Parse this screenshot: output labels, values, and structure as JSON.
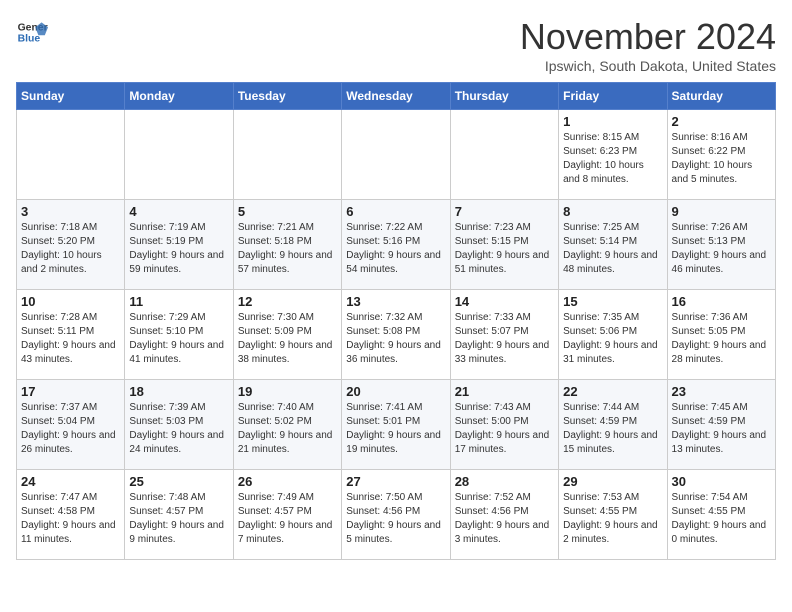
{
  "header": {
    "logo_line1": "General",
    "logo_line2": "Blue",
    "month": "November 2024",
    "location": "Ipswich, South Dakota, United States"
  },
  "weekdays": [
    "Sunday",
    "Monday",
    "Tuesday",
    "Wednesday",
    "Thursday",
    "Friday",
    "Saturday"
  ],
  "weeks": [
    [
      {
        "day": "",
        "info": ""
      },
      {
        "day": "",
        "info": ""
      },
      {
        "day": "",
        "info": ""
      },
      {
        "day": "",
        "info": ""
      },
      {
        "day": "",
        "info": ""
      },
      {
        "day": "1",
        "info": "Sunrise: 8:15 AM\nSunset: 6:23 PM\nDaylight: 10 hours and 8 minutes."
      },
      {
        "day": "2",
        "info": "Sunrise: 8:16 AM\nSunset: 6:22 PM\nDaylight: 10 hours and 5 minutes."
      }
    ],
    [
      {
        "day": "3",
        "info": "Sunrise: 7:18 AM\nSunset: 5:20 PM\nDaylight: 10 hours and 2 minutes."
      },
      {
        "day": "4",
        "info": "Sunrise: 7:19 AM\nSunset: 5:19 PM\nDaylight: 9 hours and 59 minutes."
      },
      {
        "day": "5",
        "info": "Sunrise: 7:21 AM\nSunset: 5:18 PM\nDaylight: 9 hours and 57 minutes."
      },
      {
        "day": "6",
        "info": "Sunrise: 7:22 AM\nSunset: 5:16 PM\nDaylight: 9 hours and 54 minutes."
      },
      {
        "day": "7",
        "info": "Sunrise: 7:23 AM\nSunset: 5:15 PM\nDaylight: 9 hours and 51 minutes."
      },
      {
        "day": "8",
        "info": "Sunrise: 7:25 AM\nSunset: 5:14 PM\nDaylight: 9 hours and 48 minutes."
      },
      {
        "day": "9",
        "info": "Sunrise: 7:26 AM\nSunset: 5:13 PM\nDaylight: 9 hours and 46 minutes."
      }
    ],
    [
      {
        "day": "10",
        "info": "Sunrise: 7:28 AM\nSunset: 5:11 PM\nDaylight: 9 hours and 43 minutes."
      },
      {
        "day": "11",
        "info": "Sunrise: 7:29 AM\nSunset: 5:10 PM\nDaylight: 9 hours and 41 minutes."
      },
      {
        "day": "12",
        "info": "Sunrise: 7:30 AM\nSunset: 5:09 PM\nDaylight: 9 hours and 38 minutes."
      },
      {
        "day": "13",
        "info": "Sunrise: 7:32 AM\nSunset: 5:08 PM\nDaylight: 9 hours and 36 minutes."
      },
      {
        "day": "14",
        "info": "Sunrise: 7:33 AM\nSunset: 5:07 PM\nDaylight: 9 hours and 33 minutes."
      },
      {
        "day": "15",
        "info": "Sunrise: 7:35 AM\nSunset: 5:06 PM\nDaylight: 9 hours and 31 minutes."
      },
      {
        "day": "16",
        "info": "Sunrise: 7:36 AM\nSunset: 5:05 PM\nDaylight: 9 hours and 28 minutes."
      }
    ],
    [
      {
        "day": "17",
        "info": "Sunrise: 7:37 AM\nSunset: 5:04 PM\nDaylight: 9 hours and 26 minutes."
      },
      {
        "day": "18",
        "info": "Sunrise: 7:39 AM\nSunset: 5:03 PM\nDaylight: 9 hours and 24 minutes."
      },
      {
        "day": "19",
        "info": "Sunrise: 7:40 AM\nSunset: 5:02 PM\nDaylight: 9 hours and 21 minutes."
      },
      {
        "day": "20",
        "info": "Sunrise: 7:41 AM\nSunset: 5:01 PM\nDaylight: 9 hours and 19 minutes."
      },
      {
        "day": "21",
        "info": "Sunrise: 7:43 AM\nSunset: 5:00 PM\nDaylight: 9 hours and 17 minutes."
      },
      {
        "day": "22",
        "info": "Sunrise: 7:44 AM\nSunset: 4:59 PM\nDaylight: 9 hours and 15 minutes."
      },
      {
        "day": "23",
        "info": "Sunrise: 7:45 AM\nSunset: 4:59 PM\nDaylight: 9 hours and 13 minutes."
      }
    ],
    [
      {
        "day": "24",
        "info": "Sunrise: 7:47 AM\nSunset: 4:58 PM\nDaylight: 9 hours and 11 minutes."
      },
      {
        "day": "25",
        "info": "Sunrise: 7:48 AM\nSunset: 4:57 PM\nDaylight: 9 hours and 9 minutes."
      },
      {
        "day": "26",
        "info": "Sunrise: 7:49 AM\nSunset: 4:57 PM\nDaylight: 9 hours and 7 minutes."
      },
      {
        "day": "27",
        "info": "Sunrise: 7:50 AM\nSunset: 4:56 PM\nDaylight: 9 hours and 5 minutes."
      },
      {
        "day": "28",
        "info": "Sunrise: 7:52 AM\nSunset: 4:56 PM\nDaylight: 9 hours and 3 minutes."
      },
      {
        "day": "29",
        "info": "Sunrise: 7:53 AM\nSunset: 4:55 PM\nDaylight: 9 hours and 2 minutes."
      },
      {
        "day": "30",
        "info": "Sunrise: 7:54 AM\nSunset: 4:55 PM\nDaylight: 9 hours and 0 minutes."
      }
    ]
  ]
}
